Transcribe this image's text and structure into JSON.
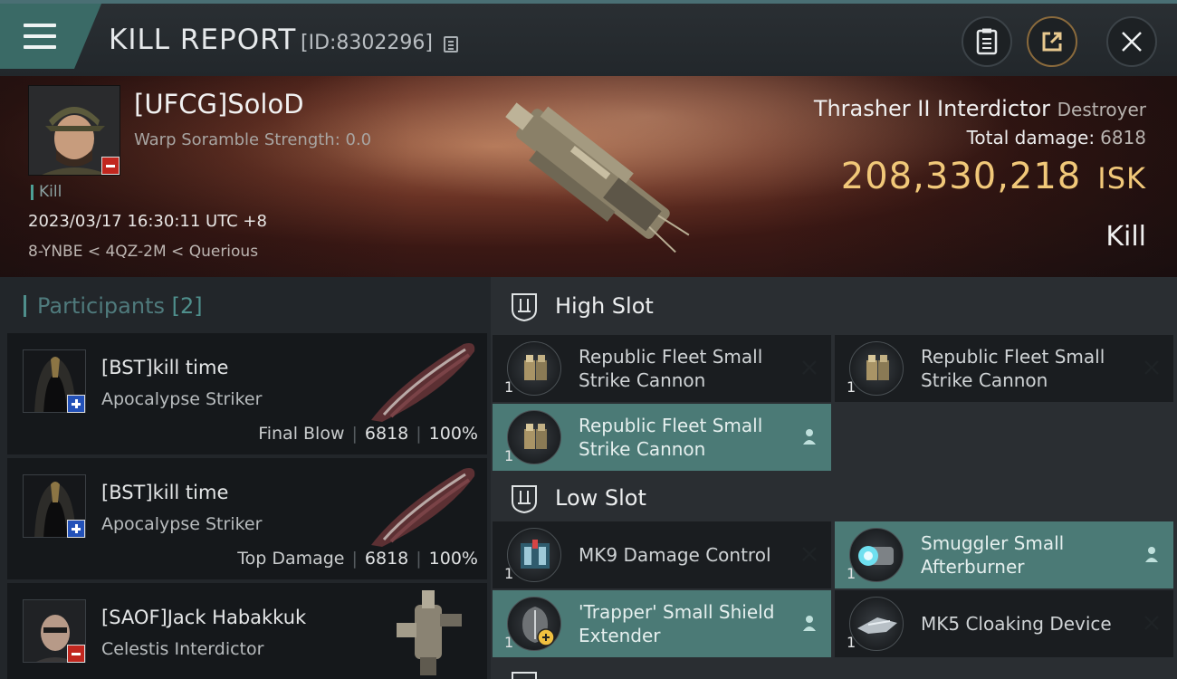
{
  "header": {
    "title": "KILL REPORT",
    "report_id": "[ID:8302296]"
  },
  "victim": {
    "name": "[UFCG]SoloD",
    "warp_scramble": "Warp Soramble Strength: 0.0",
    "kill_tag": "Kill",
    "datetime": "2023/03/17 16:30:11 UTC +8",
    "location": "8-YNBE < 4QZ-2M < Querious",
    "ship": "Thrasher II Interdictor",
    "ship_class": "Destroyer",
    "total_damage_label": "Total damage:",
    "total_damage": "6818",
    "isk_value": "208,330,218",
    "isk_unit": "ISK",
    "result": "Kill"
  },
  "participants": {
    "label": "Participants",
    "count": "[2]",
    "rows": [
      {
        "name": "[BST]kill time",
        "ship": "Apocalypse Striker",
        "role": "Final Blow",
        "damage": "6818",
        "percent": "100%"
      },
      {
        "name": "[BST]kill time",
        "ship": "Apocalypse Striker",
        "role": "Top Damage",
        "damage": "6818",
        "percent": "100%"
      },
      {
        "name": "[SAOF]Jack Habakkuk",
        "ship": "Celestis Interdictor"
      }
    ]
  },
  "slots": {
    "high": {
      "label": "High Slot",
      "items": [
        {
          "name": "Republic Fleet Small Strike Cannon",
          "qty": "1",
          "status": "destroyed"
        },
        {
          "name": "Republic Fleet Small Strike Cannon",
          "qty": "1",
          "status": "destroyed"
        },
        {
          "name": "Republic Fleet Small Strike Cannon",
          "qty": "1",
          "status": "dropped"
        }
      ]
    },
    "low": {
      "label": "Low Slot",
      "items": [
        {
          "name": "MK9 Damage Control",
          "qty": "1",
          "status": "destroyed"
        },
        {
          "name": "Smuggler Small Afterburner",
          "qty": "1",
          "status": "dropped"
        },
        {
          "name": "'Trapper' Small Shield Extender",
          "qty": "1",
          "status": "dropped"
        },
        {
          "name": "MK5 Cloaking Device",
          "qty": "1",
          "status": "destroyed"
        }
      ]
    }
  },
  "colors": {
    "accent_teal": "#4b7a76",
    "isk_gold": "#f1c879",
    "badge_red": "#c1271f",
    "badge_blue": "#2351b8"
  }
}
